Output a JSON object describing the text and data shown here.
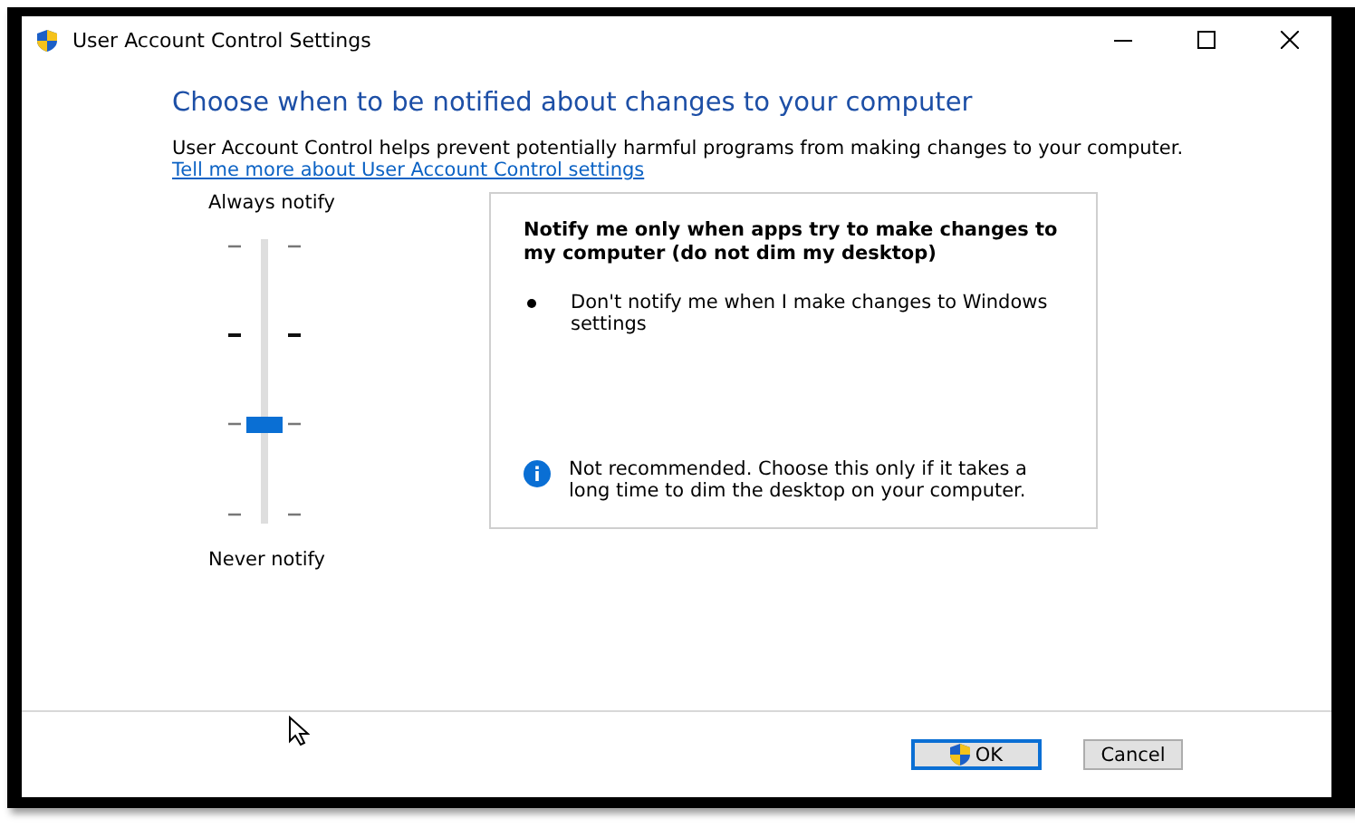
{
  "window": {
    "title": "User Account Control Settings"
  },
  "heading": "Choose when to be notified about changes to your computer",
  "description": "User Account Control helps prevent potentially harmful programs from making changes to your computer.",
  "link": "Tell me more about User Account Control settings",
  "slider": {
    "top_label": "Always notify",
    "bottom_label": "Never notify",
    "level": 0.333
  },
  "panel": {
    "title": "Notify me only when apps try to make changes to my computer (do not dim my desktop)",
    "bullets": [
      "Don't notify me when I make changes to Windows settings"
    ],
    "note": "Not recommended. Choose this only if it takes a long time to dim the desktop on your computer."
  },
  "buttons": [
    {
      "label": "OK",
      "kind": "shield",
      "default": true
    },
    {
      "label": "Cancel",
      "kind": "plain",
      "default": false
    }
  ]
}
